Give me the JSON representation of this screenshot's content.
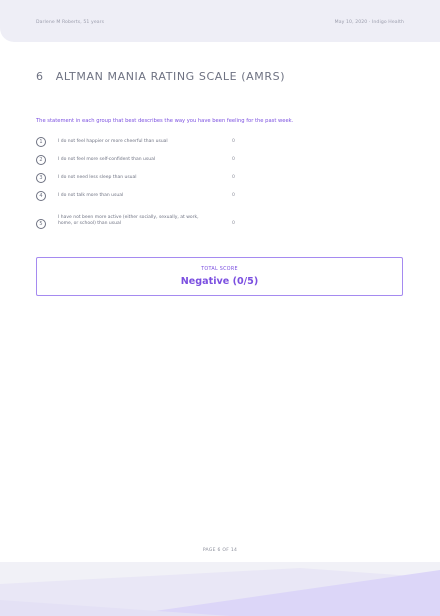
{
  "header": {
    "patient": "Darlene M Roberts, 51 years",
    "date_org": "May 10, 2020 · Indigo Health"
  },
  "section": {
    "number": "6",
    "title": "ALTMAN MANIA RATING SCALE (AMRS)",
    "instruction": "The statement in each group that best describes the way you have been feeling for the past week."
  },
  "items": [
    {
      "number": "1",
      "text": "I do not feel happier or more cheerful than usual",
      "score": "0"
    },
    {
      "number": "2",
      "text": "I do not feel more self-confident than usual",
      "score": "0"
    },
    {
      "number": "3",
      "text": "I do not need less sleep than usual",
      "score": "0"
    },
    {
      "number": "4",
      "text": "I do not talk more than usual",
      "score": "0"
    },
    {
      "number": "5",
      "text": "I have not been more active (either socially, sexually, at work, home, or school) than usual",
      "score": "0"
    }
  ],
  "total": {
    "label": "TOTAL SCORE",
    "value": "Negative (0/5)"
  },
  "footer": {
    "page": "PAGE 6 OF 14"
  },
  "colors": {
    "accent": "#7b4fe0",
    "header_band": "#eeeef6",
    "text": "#6e7282"
  }
}
